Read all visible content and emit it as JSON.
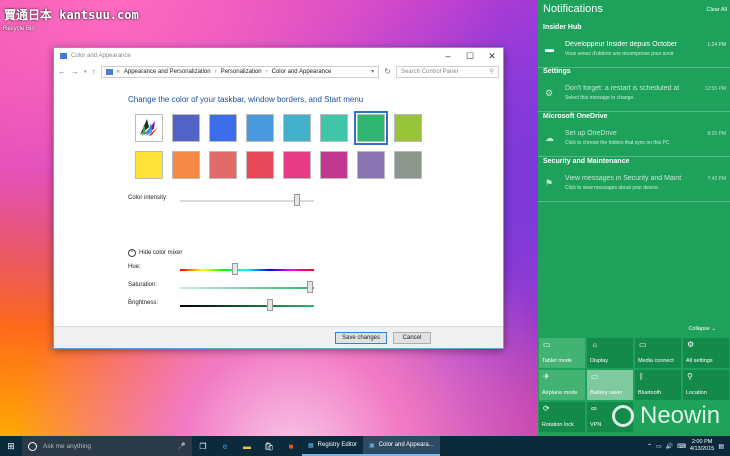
{
  "desktop": {
    "watermark": "賈通日本 kantsuu.com",
    "recycle_bin": "Recycle Bin"
  },
  "window": {
    "title": "Color and Appearance",
    "breadcrumb": [
      "Appearance and Personalization",
      "Personalization",
      "Color and Appearance"
    ],
    "search_placeholder": "Search Control Panel",
    "heading": "Change the color of your taskbar, window borders, and Start menu",
    "swatches_row1": [
      "#ffffff",
      "#5163c6",
      "#3b6ee8",
      "#4a9bde",
      "#41b0c9",
      "#3fc6a9",
      "#2fb771",
      "#98c43c"
    ],
    "swatches_row2": [
      "#ffe43a",
      "#f48a46",
      "#e06a6a",
      "#e8495a",
      "#e83b86",
      "#c0398e",
      "#8774b0",
      "#8c968d"
    ],
    "selected_swatch": 6,
    "color_intensity_label": "Color intensity:",
    "hide_mixer_label": "Hide color mixer",
    "hue_label": "Hue:",
    "saturation_label": "Saturation:",
    "brightness_label": "Brightness:",
    "color_intensity_level": 0.87,
    "hue_level": 0.41,
    "saturation_level": 0.97,
    "brightness_level": 0.67,
    "save_label": "Save changes",
    "cancel_label": "Cancel"
  },
  "action_center": {
    "title": "Notifications",
    "clear_all": "Clear All",
    "groups": [
      {
        "name": "Insider Hub",
        "items": [
          {
            "icon": "megaphone-icon",
            "title": "Développeur Insider depuis October",
            "body": "Vous venez d'obtenir une récompense pour avoir",
            "time": "1:24 PM",
            "dim": false
          }
        ]
      },
      {
        "name": "Settings",
        "items": [
          {
            "icon": "gear-icon",
            "title": "Don't forget: a restart is scheduled at",
            "body": "Select this message to change.",
            "time": "12:55 PM",
            "dim": true
          }
        ]
      },
      {
        "name": "Microsoft OneDrive",
        "items": [
          {
            "icon": "cloud-icon",
            "title": "Set up OneDrive",
            "body": "Click to choose the folders that sync on this PC",
            "time": "8:25 PM",
            "dim": true
          }
        ]
      },
      {
        "name": "Security and Maintenance",
        "items": [
          {
            "icon": "flag-icon",
            "title": "View messages in Security and Maint",
            "body": "Click to view messages about your device.",
            "time": "7:43 PM",
            "dim": true
          }
        ]
      }
    ],
    "collapse": "Collapse",
    "tiles": [
      {
        "label": "Tablet mode",
        "icon": "tablet-icon",
        "state": "on"
      },
      {
        "label": "Display",
        "icon": "display-icon",
        "state": "off"
      },
      {
        "label": "Media connect",
        "icon": "cast-icon",
        "state": "off"
      },
      {
        "label": "All settings",
        "icon": "gear-icon",
        "state": "off"
      },
      {
        "label": "Airplane mode",
        "icon": "airplane-icon",
        "state": "on"
      },
      {
        "label": "Battery saver",
        "icon": "battery-icon",
        "state": "lit"
      },
      {
        "label": "Bluetooth",
        "icon": "bluetooth-icon",
        "state": "off"
      },
      {
        "label": "Location",
        "icon": "location-icon",
        "state": "off"
      },
      {
        "label": "Rotation lock",
        "icon": "rotation-icon",
        "state": "off"
      },
      {
        "label": "VPN",
        "icon": "vpn-icon",
        "state": "off"
      }
    ]
  },
  "watermark": "Neowin",
  "taskbar": {
    "search_placeholder": "Ask me anything",
    "apps": [
      {
        "label": "Registry Editor"
      },
      {
        "label": "Color and Appeara..."
      }
    ],
    "time": "2:00 PM",
    "date": "4/13/2015"
  }
}
